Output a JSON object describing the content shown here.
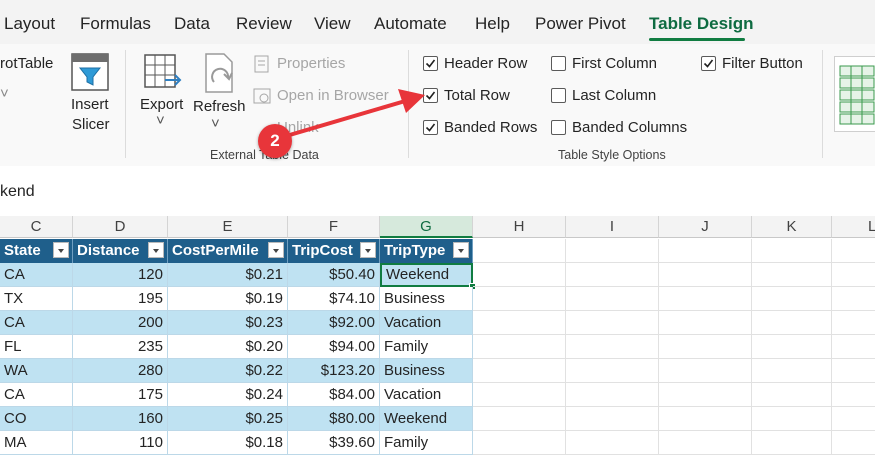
{
  "menu": {
    "tabs": [
      "Layout",
      "Formulas",
      "Data",
      "Review",
      "View",
      "Automate",
      "Help",
      "Power Pivot",
      "Table Design"
    ],
    "active_tab": "Table Design"
  },
  "ribbon": {
    "pivot_partial": "rotTable",
    "insert_slicer": [
      "Insert",
      "Slicer"
    ],
    "export": "Export",
    "refresh": "Refresh",
    "properties": "Properties",
    "open_in_browser": "Open in Browser",
    "unlink": "Unlink",
    "external_group": "External Table Data",
    "style_options_group": "Table Style Options",
    "options": [
      {
        "label": "Header Row",
        "checked": true
      },
      {
        "label": "Total Row",
        "checked": true
      },
      {
        "label": "Banded Rows",
        "checked": true
      },
      {
        "label": "First Column",
        "checked": false
      },
      {
        "label": "Last Column",
        "checked": false
      },
      {
        "label": "Banded Columns",
        "checked": false
      },
      {
        "label": "Filter Button",
        "checked": true
      }
    ],
    "callout_number": "2"
  },
  "formula_bar": {
    "value": "kend"
  },
  "grid": {
    "columns": [
      "C",
      "D",
      "E",
      "F",
      "G",
      "H",
      "I",
      "J",
      "K",
      "L"
    ],
    "selected_column": "G",
    "table_headers": [
      "State",
      "Distance",
      "CostPerMile",
      "TripCost",
      "TripType"
    ],
    "rows": [
      [
        "CA",
        "120",
        "$0.21",
        "$50.40",
        "Weekend"
      ],
      [
        "TX",
        "195",
        "$0.19",
        "$74.10",
        "Business"
      ],
      [
        "CA",
        "200",
        "$0.23",
        "$92.00",
        "Vacation"
      ],
      [
        "FL",
        "235",
        "$0.20",
        "$94.00",
        "Family"
      ],
      [
        "WA",
        "280",
        "$0.22",
        "$123.20",
        "Business"
      ],
      [
        "CA",
        "175",
        "$0.24",
        "$84.00",
        "Vacation"
      ],
      [
        "CO",
        "160",
        "$0.25",
        "$80.00",
        "Weekend"
      ],
      [
        "MA",
        "110",
        "$0.18",
        "$39.60",
        "Family"
      ]
    ]
  },
  "colors": {
    "accent": "#107c41",
    "table_header": "#1f5f8b",
    "band": "#bfe2f2",
    "callout": "#e8353a"
  }
}
